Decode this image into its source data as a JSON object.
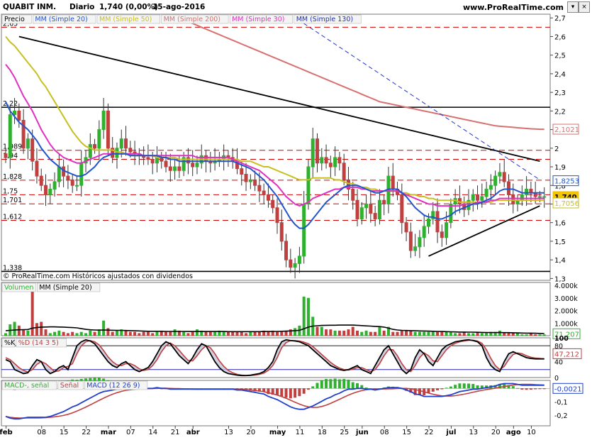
{
  "header": {
    "symbol": "QUABIT INM.",
    "period": "Diario",
    "last": "1,740 (0,00%)",
    "date": "15-ago-2016",
    "site": "www.ProRealTime.com"
  },
  "colors": {
    "up": "#2fb12f",
    "down": "#c04040",
    "ma20": "#2255cc",
    "ma50": "#c8c020",
    "ma200": "#d87070",
    "ma30": "#e030c0",
    "ma130": "#2233aa",
    "level": "#d00000"
  },
  "price_panel": {
    "legend": [
      "Precio",
      "MM (Simple 20)",
      "MM (Simple 50)",
      "MM (Simple 200)",
      "MM (Simple 30)",
      "MM (Simple 130)"
    ],
    "footer": "© ProRealTime.com Históricos ajustados con dividendos",
    "level_labels": [
      "2,65",
      "2,22",
      "1,989",
      "1,94",
      "1,828",
      "1,75",
      "1,701",
      "1,612",
      "1,338"
    ],
    "badges": [
      "2,1021",
      "1,8253",
      "1,740",
      "1,7056"
    ]
  },
  "volume_panel": {
    "legend": [
      "Volumen",
      "MM (Simple 20)"
    ],
    "badge": "71.207"
  },
  "stoch_panel": {
    "legend": [
      "%K",
      "%D (14 3 5)"
    ],
    "badge": "47,212"
  },
  "macd_panel": {
    "legend": [
      "MACD-, señal",
      "Señal",
      "MACD (12 26 9)"
    ],
    "badge": "-0,0021"
  },
  "chart_data": {
    "type": "candlestick",
    "x_ticks": [
      "feb",
      "08",
      "15",
      "22",
      "mar",
      "07",
      "14",
      "21",
      "abr",
      "13",
      "20",
      "may",
      "11",
      "18",
      "25",
      "jun",
      "08",
      "15",
      "22",
      "jul",
      "13",
      "20",
      "ago",
      "10"
    ],
    "price_axis": {
      "ticks": [
        "2,7",
        "2,6",
        "2,5",
        "2,4",
        "2,3",
        "2,2",
        "2,1",
        "2",
        "1,9",
        "1,8",
        "1,7",
        "1,6",
        "1,5",
        "1,4",
        "1,3"
      ],
      "ylim": [
        1.29,
        2.72
      ]
    },
    "horizontal_levels": [
      2.65,
      2.22,
      1.989,
      1.94,
      1.828,
      1.75,
      1.701,
      1.612,
      1.338
    ],
    "close": [
      1.95,
      2.18,
      2.2,
      2.15,
      2.0,
      2.05,
      1.93,
      1.85,
      1.8,
      1.75,
      1.78,
      1.82,
      1.9,
      1.85,
      1.83,
      1.8,
      1.8,
      1.92,
      1.95,
      2.02,
      2.0,
      2.1,
      2.2,
      2.0,
      1.95,
      2.0,
      2.05,
      2.0,
      1.98,
      1.97,
      1.96,
      1.95,
      1.94,
      1.92,
      1.95,
      1.93,
      1.9,
      1.88,
      1.9,
      1.88,
      1.95,
      1.92,
      1.9,
      1.92,
      1.96,
      1.93,
      1.92,
      1.93,
      1.94,
      1.96,
      1.95,
      1.93,
      1.89,
      1.86,
      1.82,
      1.83,
      1.8,
      1.77,
      1.75,
      1.72,
      1.68,
      1.6,
      1.5,
      1.4,
      1.36,
      1.38,
      1.42,
      1.7,
      1.9,
      2.05,
      1.92,
      1.95,
      1.92,
      1.9,
      1.95,
      1.92,
      1.83,
      1.78,
      1.72,
      1.62,
      1.68,
      1.7,
      1.65,
      1.62,
      1.72,
      1.7,
      1.85,
      1.78,
      1.75,
      1.6,
      1.55,
      1.45,
      1.47,
      1.52,
      1.58,
      1.62,
      1.66,
      1.55,
      1.52,
      1.6,
      1.7,
      1.73,
      1.7,
      1.67,
      1.72,
      1.75,
      1.72,
      1.74,
      1.78,
      1.8,
      1.85,
      1.87,
      1.82,
      1.75,
      1.7,
      1.72,
      1.75,
      1.78,
      1.76,
      1.74,
      1.74,
      1.74
    ],
    "ma20": [
      2.25,
      2.2,
      2.17,
      2.14,
      2.12,
      2.1,
      2.07,
      2.04,
      2.0,
      1.97,
      1.94,
      1.92,
      1.9,
      1.88,
      1.87,
      1.86,
      1.85,
      1.85,
      1.86,
      1.88,
      1.9,
      1.93,
      1.95,
      1.96,
      1.97,
      1.97,
      1.97,
      1.97,
      1.96,
      1.96,
      1.96,
      1.96,
      1.96,
      1.96,
      1.96,
      1.95,
      1.95,
      1.94,
      1.94,
      1.93,
      1.93,
      1.93,
      1.93,
      1.93,
      1.93,
      1.93,
      1.93,
      1.93,
      1.93,
      1.93,
      1.93,
      1.93,
      1.92,
      1.91,
      1.9,
      1.89,
      1.87,
      1.85,
      1.83,
      1.8,
      1.77,
      1.74,
      1.7,
      1.66,
      1.62,
      1.59,
      1.57,
      1.57,
      1.59,
      1.62,
      1.65,
      1.68,
      1.71,
      1.73,
      1.75,
      1.77,
      1.79,
      1.8,
      1.8,
      1.8,
      1.79,
      1.78,
      1.77,
      1.76,
      1.76,
      1.77,
      1.78,
      1.78,
      1.78,
      1.76,
      1.74,
      1.71,
      1.68,
      1.66,
      1.64,
      1.63,
      1.63,
      1.62,
      1.62,
      1.63,
      1.64,
      1.66,
      1.67,
      1.68,
      1.69,
      1.7,
      1.7,
      1.71,
      1.72,
      1.73,
      1.75,
      1.77,
      1.78,
      1.78,
      1.78,
      1.77,
      1.76,
      1.76,
      1.76,
      1.76,
      1.76,
      1.76
    ],
    "ma50": [
      2.6,
      2.57,
      2.55,
      2.52,
      2.49,
      2.46,
      2.43,
      2.4,
      2.36,
      2.33,
      2.29,
      2.25,
      2.21,
      2.17,
      2.13,
      2.09,
      2.06,
      2.03,
      2.01,
      2.0,
      1.99,
      1.99,
      1.99,
      1.99,
      1.99,
      1.98,
      1.98,
      1.97,
      1.97,
      1.96,
      1.96,
      1.96,
      1.96,
      1.96,
      1.95,
      1.95,
      1.95,
      1.95,
      1.95,
      1.94,
      1.94,
      1.94,
      1.94,
      1.94,
      1.94,
      1.94,
      1.94,
      1.94,
      1.94,
      1.94,
      1.94,
      1.94,
      1.94,
      1.93,
      1.93,
      1.93,
      1.92,
      1.91,
      1.9,
      1.9,
      1.89,
      1.88,
      1.87,
      1.86,
      1.85,
      1.84,
      1.83,
      1.83,
      1.83,
      1.84,
      1.84,
      1.84,
      1.84,
      1.84,
      1.83,
      1.83,
      1.82,
      1.81,
      1.81,
      1.8,
      1.79,
      1.79,
      1.78,
      1.78,
      1.77,
      1.77,
      1.77,
      1.77,
      1.77,
      1.76,
      1.76,
      1.75,
      1.75,
      1.74,
      1.74,
      1.73,
      1.73,
      1.72,
      1.72,
      1.72,
      1.72,
      1.72,
      1.71,
      1.71,
      1.71,
      1.71,
      1.71,
      1.71,
      1.71,
      1.71,
      1.72,
      1.72,
      1.72,
      1.72,
      1.72,
      1.72,
      1.72,
      1.72,
      1.72,
      1.72,
      1.72,
      1.72
    ],
    "ma200": [
      3.5,
      3.48,
      3.46,
      3.44,
      3.42,
      3.4,
      3.38,
      3.36,
      3.34,
      3.32,
      3.3,
      3.28,
      3.26,
      3.24,
      3.22,
      3.2,
      3.18,
      3.16,
      3.14,
      3.12,
      3.1,
      3.08,
      3.06,
      3.04,
      3.02,
      3.0,
      2.98,
      2.96,
      2.94,
      2.92,
      2.9,
      2.88,
      2.86,
      2.84,
      2.82,
      2.8,
      2.78,
      2.76,
      2.74,
      2.72,
      2.7,
      2.68,
      2.67,
      2.66,
      2.65,
      2.64,
      2.63,
      2.62,
      2.61,
      2.6,
      2.59,
      2.58,
      2.57,
      2.56,
      2.55,
      2.54,
      2.53,
      2.52,
      2.51,
      2.5,
      2.49,
      2.48,
      2.47,
      2.46,
      2.45,
      2.44,
      2.43,
      2.42,
      2.41,
      2.4,
      2.39,
      2.38,
      2.37,
      2.36,
      2.35,
      2.34,
      2.33,
      2.32,
      2.31,
      2.3,
      2.29,
      2.28,
      2.27,
      2.26,
      2.25,
      2.245,
      2.24,
      2.235,
      2.23,
      2.225,
      2.22,
      2.215,
      2.21,
      2.205,
      2.2,
      2.195,
      2.19,
      2.185,
      2.18,
      2.175,
      2.17,
      2.165,
      2.16,
      2.155,
      2.15,
      2.145,
      2.14,
      2.135,
      2.13,
      2.125,
      2.12,
      2.118,
      2.116,
      2.114,
      2.112,
      2.11,
      2.108,
      2.106,
      2.104,
      2.103,
      2.102,
      2.102
    ],
    "ma30": [
      2.45,
      2.42,
      2.38,
      2.33,
      2.28,
      2.24,
      2.2,
      2.15,
      2.1,
      2.06,
      2.02,
      1.99,
      1.97,
      1.95,
      1.94,
      1.93,
      1.92,
      1.92,
      1.93,
      1.94,
      1.95,
      1.96,
      1.97,
      1.97,
      1.97,
      1.97,
      1.97,
      1.97,
      1.97,
      1.97,
      1.97,
      1.96,
      1.96,
      1.96,
      1.96,
      1.96,
      1.96,
      1.96,
      1.96,
      1.96,
      1.96,
      1.96,
      1.96,
      1.95,
      1.95,
      1.95,
      1.95,
      1.95,
      1.95,
      1.95,
      1.95,
      1.94,
      1.93,
      1.92,
      1.91,
      1.9,
      1.89,
      1.88,
      1.86,
      1.84,
      1.82,
      1.8,
      1.77,
      1.74,
      1.72,
      1.7,
      1.69,
      1.7,
      1.71,
      1.73,
      1.74,
      1.75,
      1.76,
      1.77,
      1.78,
      1.78,
      1.79,
      1.79,
      1.79,
      1.79,
      1.78,
      1.78,
      1.77,
      1.77,
      1.77,
      1.77,
      1.77,
      1.77,
      1.77,
      1.76,
      1.75,
      1.74,
      1.73,
      1.72,
      1.71,
      1.7,
      1.7,
      1.69,
      1.69,
      1.69,
      1.69,
      1.69,
      1.69,
      1.7,
      1.7,
      1.7,
      1.71,
      1.71,
      1.71,
      1.72,
      1.72,
      1.73,
      1.73,
      1.73,
      1.73,
      1.73,
      1.73,
      1.73,
      1.73,
      1.73,
      1.73,
      1.73
    ],
    "trendlines": [
      {
        "from": [
          3,
          2.6
        ],
        "to": [
          120,
          1.93
        ],
        "style": "solid"
      },
      {
        "from": [
          55,
          2.86
        ],
        "to": [
          120,
          1.83
        ],
        "style": "dashed"
      },
      {
        "from": [
          95,
          1.42
        ],
        "to": [
          120,
          1.69
        ],
        "style": "solid"
      }
    ],
    "volume_axis": {
      "ticks": [
        "4.000k",
        "3.000k",
        "2.000k",
        "1.000k",
        "0"
      ],
      "ylim": [
        0,
        4000
      ]
    },
    "volume": [
      200,
      900,
      1100,
      800,
      500,
      400,
      3600,
      1000,
      1100,
      500,
      200,
      300,
      400,
      300,
      200,
      300,
      200,
      300,
      200,
      400,
      300,
      500,
      1200,
      600,
      300,
      400,
      500,
      400,
      300,
      300,
      200,
      300,
      300,
      200,
      300,
      400,
      300,
      300,
      500,
      400,
      300,
      200,
      300,
      500,
      400,
      300,
      300,
      300,
      400,
      300,
      300,
      300,
      300,
      300,
      200,
      300,
      300,
      300,
      400,
      300,
      400,
      300,
      300,
      400,
      500,
      600,
      800,
      3100,
      3000,
      1500,
      700,
      700,
      500,
      500,
      400,
      400,
      400,
      500,
      700,
      400,
      300,
      400,
      300,
      300,
      700,
      400,
      700,
      300,
      300,
      400,
      400,
      400,
      300,
      300,
      300,
      300,
      300,
      300,
      300,
      300,
      300,
      200,
      200,
      300,
      200,
      200,
      300,
      200,
      200,
      300,
      300,
      400,
      200,
      200,
      200,
      200,
      100,
      100,
      200,
      100,
      100,
      100
    ],
    "volume_ma20": [
      400,
      420,
      450,
      470,
      480,
      490,
      600,
      650,
      680,
      690,
      700,
      700,
      690,
      680,
      660,
      640,
      620,
      560,
      500,
      470,
      450,
      440,
      450,
      440,
      430,
      420,
      420,
      410,
      400,
      390,
      380,
      360,
      350,
      350,
      350,
      350,
      340,
      340,
      340,
      340,
      340,
      330,
      330,
      330,
      330,
      330,
      330,
      330,
      330,
      330,
      320,
      320,
      320,
      320,
      320,
      320,
      320,
      320,
      330,
      330,
      340,
      340,
      350,
      360,
      380,
      400,
      430,
      550,
      680,
      760,
      790,
      810,
      820,
      830,
      830,
      840,
      840,
      840,
      840,
      820,
      800,
      780,
      760,
      740,
      720,
      680,
      600,
      500,
      450,
      420,
      410,
      400,
      390,
      380,
      370,
      360,
      350,
      340,
      330,
      320,
      310,
      300,
      290,
      290,
      280,
      280,
      270,
      260,
      250,
      250,
      250,
      250,
      240,
      240,
      230,
      220,
      210,
      200,
      200,
      190,
      180,
      170
    ],
    "stoch_axis": {
      "ticks": [
        "100",
        "80",
        "40",
        "0"
      ],
      "ylim": [
        0,
        100
      ]
    },
    "stoch_k": [
      45,
      40,
      20,
      15,
      10,
      12,
      30,
      45,
      40,
      20,
      10,
      15,
      25,
      30,
      20,
      50,
      80,
      90,
      95,
      92,
      85,
      70,
      55,
      40,
      30,
      25,
      35,
      40,
      30,
      20,
      15,
      20,
      25,
      40,
      60,
      80,
      90,
      85,
      70,
      55,
      45,
      35,
      50,
      70,
      85,
      80,
      60,
      40,
      25,
      15,
      10,
      8,
      6,
      5,
      5,
      6,
      8,
      10,
      15,
      25,
      40,
      70,
      90,
      95,
      93,
      92,
      90,
      85,
      80,
      70,
      60,
      50,
      40,
      30,
      25,
      20,
      18,
      20,
      25,
      30,
      20,
      15,
      10,
      30,
      50,
      70,
      80,
      60,
      40,
      20,
      10,
      20,
      50,
      70,
      60,
      40,
      30,
      50,
      70,
      80,
      85,
      90,
      92,
      94,
      95,
      93,
      90,
      80,
      50,
      30,
      20,
      15,
      40,
      60,
      65,
      60,
      55,
      50,
      48,
      47,
      47,
      47
    ],
    "stoch_d": [
      50,
      45,
      35,
      25,
      18,
      14,
      20,
      33,
      40,
      35,
      25,
      15,
      17,
      25,
      28,
      35,
      60,
      80,
      90,
      93,
      90,
      82,
      68,
      52,
      40,
      32,
      30,
      35,
      35,
      30,
      22,
      18,
      20,
      30,
      45,
      65,
      80,
      87,
      80,
      68,
      55,
      43,
      42,
      55,
      70,
      80,
      75,
      60,
      42,
      28,
      18,
      12,
      8,
      6,
      5,
      5,
      6,
      8,
      11,
      18,
      30,
      50,
      75,
      88,
      93,
      93,
      92,
      89,
      85,
      78,
      68,
      58,
      48,
      38,
      30,
      24,
      20,
      19,
      21,
      25,
      25,
      20,
      15,
      20,
      35,
      55,
      70,
      70,
      55,
      35,
      20,
      15,
      30,
      50,
      62,
      55,
      42,
      40,
      55,
      70,
      80,
      86,
      90,
      92,
      94,
      94,
      92,
      86,
      70,
      48,
      30,
      20,
      28,
      45,
      58,
      62,
      60,
      55,
      51,
      49,
      48,
      47
    ]
  }
}
